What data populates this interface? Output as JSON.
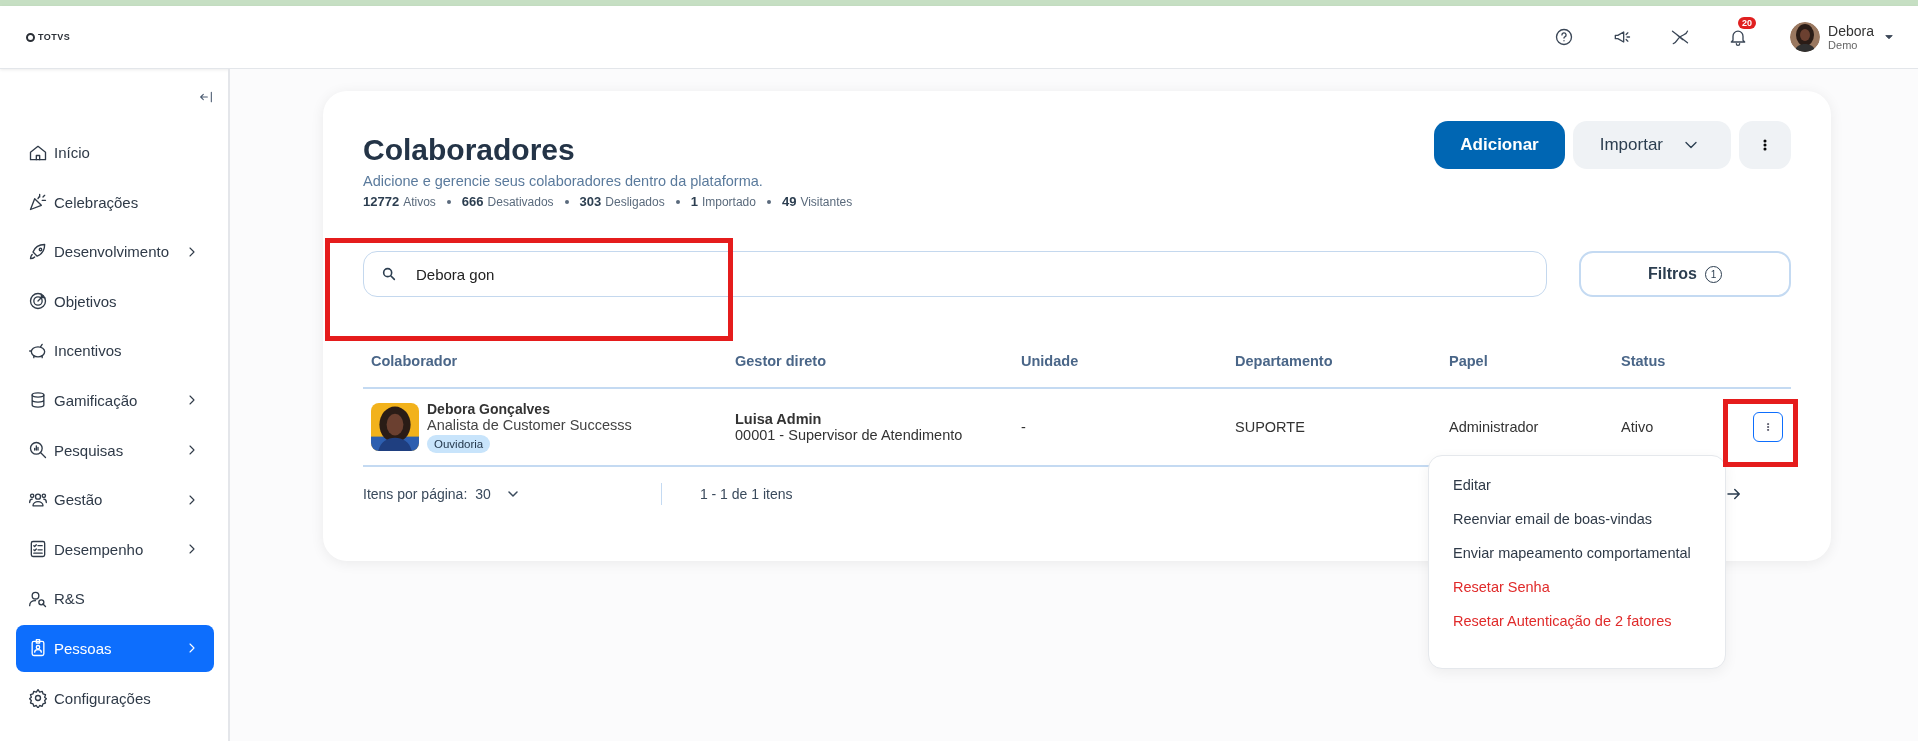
{
  "topbar": {
    "logo": "TOTVS",
    "notification_count": "20",
    "user": {
      "name": "Debora",
      "subtitle": "Demo"
    }
  },
  "sidebar": {
    "items": [
      {
        "label": "Início",
        "has_submenu": false,
        "selected": false
      },
      {
        "label": "Celebrações",
        "has_submenu": false,
        "selected": false
      },
      {
        "label": "Desenvolvimento",
        "has_submenu": true,
        "selected": false
      },
      {
        "label": "Objetivos",
        "has_submenu": false,
        "selected": false
      },
      {
        "label": "Incentivos",
        "has_submenu": false,
        "selected": false
      },
      {
        "label": "Gamificação",
        "has_submenu": true,
        "selected": false
      },
      {
        "label": "Pesquisas",
        "has_submenu": true,
        "selected": false
      },
      {
        "label": "Gestão",
        "has_submenu": true,
        "selected": false
      },
      {
        "label": "Desempenho",
        "has_submenu": true,
        "selected": false
      },
      {
        "label": "R&S",
        "has_submenu": false,
        "selected": false
      },
      {
        "label": "Pessoas",
        "has_submenu": true,
        "selected": true
      },
      {
        "label": "Configurações",
        "has_submenu": false,
        "selected": false
      }
    ]
  },
  "page": {
    "title": "Colaboradores",
    "subtitle": "Adicione e gerencie seus colaboradores dentro da plataforma.",
    "stats": [
      {
        "value": "12772",
        "label": "Ativos"
      },
      {
        "value": "666",
        "label": "Desativados"
      },
      {
        "value": "303",
        "label": "Desligados"
      },
      {
        "value": "1",
        "label": "Importado"
      },
      {
        "value": "49",
        "label": "Visitantes"
      }
    ],
    "add_button": "Adicionar",
    "import_button": "Importar"
  },
  "search": {
    "value": "Debora gon"
  },
  "filters": {
    "label": "Filtros",
    "count": "1"
  },
  "table": {
    "columns": [
      "Colaborador",
      "Gestor direto",
      "Unidade",
      "Departamento",
      "Papel",
      "Status"
    ],
    "rows": [
      {
        "name": "Debora Gonçalves",
        "role": "Analista de Customer Successs",
        "tag": "Ouvidoria",
        "manager": "Luisa Admin",
        "manager_role": "00001 - Supervisor de Atendimento",
        "unit": "-",
        "department": "SUPORTE",
        "papel": "Administrador",
        "status": "Ativo"
      }
    ]
  },
  "pagination": {
    "per_page_label": "Itens por página:",
    "per_page": "30",
    "range": "1 - 1 de 1 itens"
  },
  "row_menu": {
    "items": [
      {
        "label": "Editar",
        "kind": "normal"
      },
      {
        "label": "Reenviar email de boas-vindas",
        "kind": "normal"
      },
      {
        "label": "Enviar mapeamento comportamental",
        "kind": "normal"
      },
      {
        "label": "Resetar Senha",
        "kind": "danger"
      },
      {
        "label": "Resetar Autenticação de 2 fatores",
        "kind": "danger"
      }
    ]
  }
}
